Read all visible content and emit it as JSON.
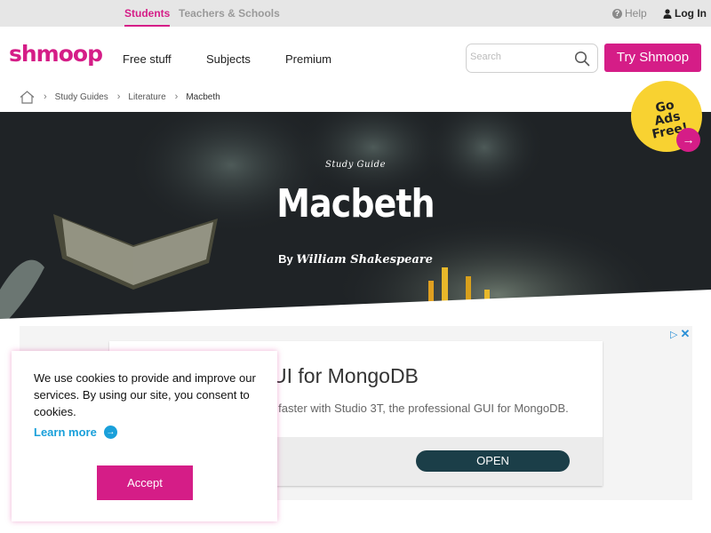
{
  "topbar": {
    "tabs": [
      {
        "label": "Students",
        "active": true
      },
      {
        "label": "Teachers & Schools",
        "active": false
      }
    ],
    "help_label": "Help",
    "login_label": "Log In"
  },
  "header": {
    "logo": "shmoop",
    "nav": [
      "Free stuff",
      "Subjects",
      "Premium"
    ],
    "search": {
      "placeholder": "Search",
      "value": ""
    },
    "cta_label": "Try Shmoop"
  },
  "breadcrumb": [
    "Study Guides",
    "Literature",
    "Macbeth"
  ],
  "hero": {
    "subtitle": "Study Guide",
    "title": "Macbeth",
    "author_prefix": "By",
    "author": "William Shakespeare"
  },
  "ads_free_badge": {
    "line1": "Go",
    "line2": "Ads Free!"
  },
  "ad": {
    "headline": "UI for MongoDB",
    "description": "er faster with Studio 3T, the professional GUI for MongoDB.",
    "button_label": "OPEN"
  },
  "cookie_banner": {
    "message": "We use cookies to provide and improve our services. By using our site, you consent to cookies.",
    "learn_more_label": "Learn more",
    "accept_label": "Accept"
  },
  "colors": {
    "brand": "#d51d87",
    "badge": "#f8d231",
    "link": "#1aa0da",
    "ad_button": "#1b3e48"
  },
  "icons": [
    "question-icon",
    "user-icon",
    "search-icon",
    "home-icon",
    "chevron-right-icon",
    "arrow-right-icon",
    "adchoices-icon",
    "close-icon"
  ]
}
